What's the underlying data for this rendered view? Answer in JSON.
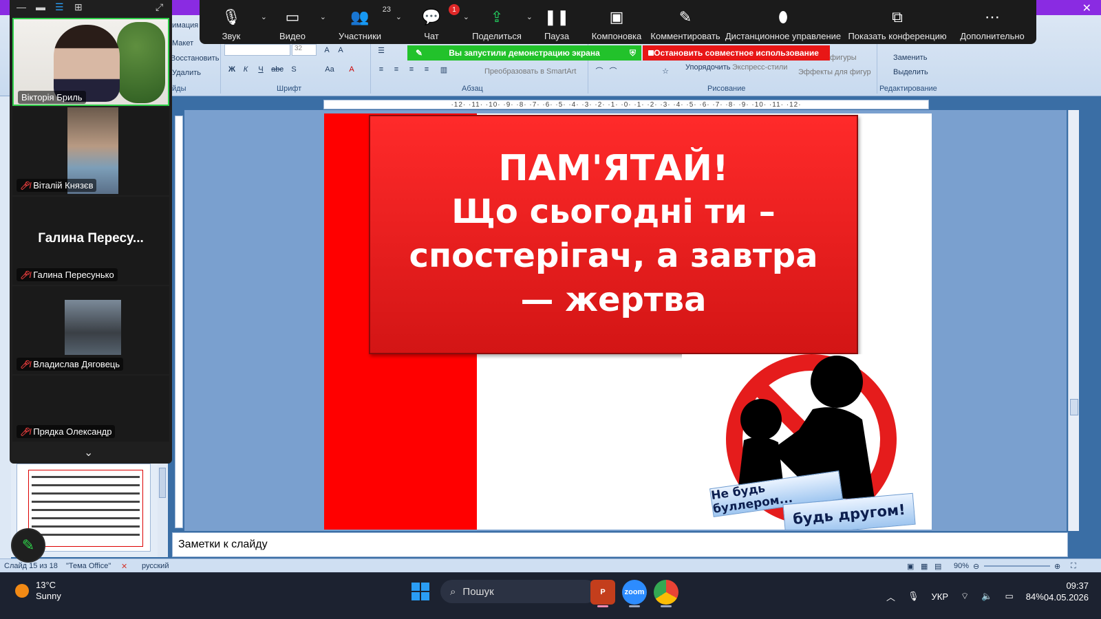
{
  "zoom": {
    "toolbar": [
      {
        "id": "audio",
        "label": "Звук",
        "icon": "microphone-icon"
      },
      {
        "id": "video",
        "label": "Видео",
        "icon": "camera-icon"
      },
      {
        "id": "participants",
        "label": "Участники",
        "icon": "people-icon",
        "count": "23"
      },
      {
        "id": "chat",
        "label": "Чат",
        "icon": "chat-icon",
        "badge": "1"
      },
      {
        "id": "share",
        "label": "Поделиться",
        "icon": "share-screen-icon"
      },
      {
        "id": "pause",
        "label": "Пауза",
        "icon": "pause-icon"
      },
      {
        "id": "layout",
        "label": "Компоновка",
        "icon": "layout-icon"
      },
      {
        "id": "annotate",
        "label": "Комментировать",
        "icon": "pen-icon"
      },
      {
        "id": "remote",
        "label": "Дистанционное управление",
        "icon": "mouse-icon"
      },
      {
        "id": "show-meeting",
        "label": "Показать конференцию",
        "icon": "window-icon"
      },
      {
        "id": "more",
        "label": "Дополнительно",
        "icon": "more-icon"
      }
    ],
    "share_banner": "Вы запустили демонстрацию экрана",
    "stop_share": "Остановить совместное использование",
    "participants": [
      {
        "name": "Вікторія Бриль",
        "muted": false
      },
      {
        "name": "Віталій Князєв",
        "muted": true
      },
      {
        "name": "Галина Пересунько",
        "display_short": "Галина  Пересу...",
        "muted": true
      },
      {
        "name": "Владислав Дяговець",
        "muted": true
      },
      {
        "name": "Прядка Олександр",
        "muted": true
      }
    ]
  },
  "ppt": {
    "ribbon": {
      "slides_group": {
        "layout": "Макет",
        "reset": "Восстановить",
        "delete": "Удалить",
        "label": "йды"
      },
      "animation_tab": "имация",
      "font_group_label": "Шрифт",
      "font_size": "32",
      "paragraph_group_label": "Абзац",
      "smartart": "Преобразовать в SmartArt",
      "drawing_group_label": "Рисование",
      "arrange": "Упорядочить",
      "quick_styles": "Экспресс-стили",
      "shape_effects": "Эффекты для фигур",
      "shape_fill": "фигуры",
      "editing_group_label": "Редактирование",
      "replace": "Заменить",
      "select": "Выделить"
    },
    "ruler": "·12· ·11· ·10· ·9· ·8· ·7· ·6· ·5· ·4· ·3· ·2· ·1· ·0· ·1· ·2· ·3· ·4· ·5· ·6· ·7· ·8· ·9· ·10· ·11· ·12·",
    "slide": {
      "title_line1": "ПАМ'ЯТАЙ!",
      "title_line2": "Що сьогодні ти – спостерігач, а завтра — жертва",
      "badge1": "Не будь буллером...",
      "badge2": "будь другом!"
    },
    "notes_placeholder": "Заметки к слайду",
    "status": {
      "slide_counter": "Слайд 15 из 18",
      "theme": "\"Тема Office\"",
      "language": "русский",
      "zoom": "90%"
    }
  },
  "taskbar": {
    "weather": {
      "temp": "13°C",
      "condition": "Sunny"
    },
    "search_placeholder": "Пошук",
    "language": "УКР",
    "battery": "84%",
    "time": "09:37",
    "date": "04.05.2026"
  }
}
